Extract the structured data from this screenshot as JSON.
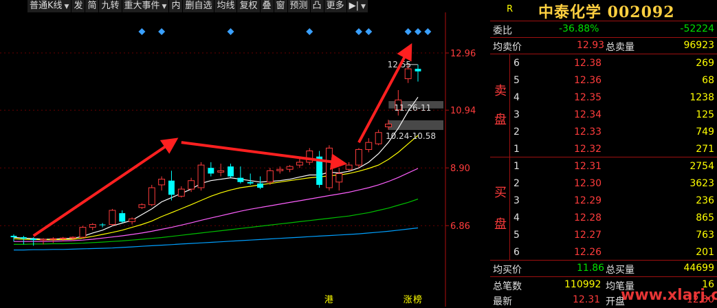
{
  "toolbar": {
    "items": [
      {
        "label": "普通K线",
        "dropdown": true
      },
      {
        "label": "发",
        "dropdown": false
      },
      {
        "label": "简",
        "dropdown": false
      },
      {
        "label": "九转",
        "dropdown": false
      },
      {
        "label": "重大事件",
        "dropdown": true
      },
      {
        "label": "内",
        "dropdown": false
      },
      {
        "label": "删自选",
        "dropdown": false
      },
      {
        "label": "均线",
        "dropdown": false
      },
      {
        "label": "复权",
        "dropdown": false
      },
      {
        "label": "叠",
        "dropdown": false
      },
      {
        "label": "窗",
        "dropdown": false
      },
      {
        "label": "预测",
        "dropdown": false
      },
      {
        "label": "凸",
        "dropdown": false
      },
      {
        "label": "更多",
        "dropdown": false
      },
      {
        "label": "▶|",
        "dropdown": true
      }
    ]
  },
  "chart_data": {
    "type": "candlestick",
    "y_ticks": [
      "12.96",
      "10.94",
      "8.90",
      "6.86"
    ],
    "ylim": [
      4.8,
      14.2
    ],
    "candles": [
      [
        6.5,
        6.55,
        6.3,
        6.45
      ],
      [
        6.45,
        6.5,
        6.2,
        6.4
      ],
      [
        6.4,
        6.45,
        6.15,
        6.35
      ],
      [
        6.35,
        6.42,
        6.2,
        6.38
      ],
      [
        6.38,
        6.45,
        6.25,
        6.4
      ],
      [
        6.4,
        6.46,
        6.3,
        6.42
      ],
      [
        6.42,
        6.48,
        6.32,
        6.45
      ],
      [
        6.45,
        6.85,
        6.4,
        6.8
      ],
      [
        6.8,
        6.95,
        6.7,
        6.9
      ],
      [
        6.9,
        6.95,
        6.8,
        6.88
      ],
      [
        6.9,
        7.45,
        6.85,
        7.4
      ],
      [
        7.3,
        7.4,
        6.95,
        7.0
      ],
      [
        7.0,
        7.15,
        6.9,
        7.1
      ],
      [
        7.5,
        7.65,
        7.45,
        7.6
      ],
      [
        7.6,
        8.3,
        7.55,
        8.2
      ],
      [
        8.3,
        8.6,
        8.1,
        8.5
      ],
      [
        8.45,
        8.8,
        7.75,
        7.95
      ],
      [
        7.9,
        8.25,
        7.85,
        8.15
      ],
      [
        8.15,
        8.55,
        8.05,
        8.45
      ],
      [
        8.2,
        9.1,
        8.1,
        9.0
      ],
      [
        8.9,
        9.1,
        8.6,
        8.7
      ],
      [
        8.75,
        9.05,
        8.6,
        8.8
      ],
      [
        8.95,
        9.05,
        8.55,
        8.6
      ],
      [
        8.55,
        8.95,
        8.35,
        8.4
      ],
      [
        8.4,
        8.7,
        8.3,
        8.35
      ],
      [
        8.35,
        8.6,
        8.15,
        8.2
      ],
      [
        8.4,
        8.9,
        8.3,
        8.8
      ],
      [
        8.8,
        8.95,
        8.7,
        8.85
      ],
      [
        8.85,
        9.0,
        8.75,
        8.95
      ],
      [
        9.0,
        9.25,
        8.9,
        9.1
      ],
      [
        9.1,
        9.6,
        9.0,
        9.5
      ],
      [
        9.3,
        9.5,
        8.2,
        8.3
      ],
      [
        8.2,
        9.7,
        8.1,
        9.6
      ],
      [
        8.4,
        8.9,
        8.1,
        8.7
      ],
      [
        8.85,
        9.1,
        8.8,
        9.0
      ],
      [
        9.0,
        9.6,
        8.9,
        9.55
      ],
      [
        9.55,
        9.95,
        9.45,
        9.8
      ],
      [
        9.75,
        10.25,
        9.7,
        10.15
      ],
      [
        10.35,
        10.6,
        10.25,
        10.45
      ],
      [
        10.95,
        11.65,
        10.75,
        11.3
      ],
      [
        12.05,
        12.55,
        11.9,
        12.4
      ],
      [
        12.4,
        12.55,
        11.95,
        12.31
      ]
    ],
    "ma_series": [
      {
        "color": "#ffffff",
        "values": [
          6.45,
          6.42,
          6.4,
          6.38,
          6.38,
          6.4,
          6.41,
          6.48,
          6.6,
          6.7,
          6.85,
          6.95,
          7.05,
          7.25,
          7.45,
          7.7,
          7.85,
          8.0,
          8.15,
          8.35,
          8.45,
          8.5,
          8.55,
          8.5,
          8.45,
          8.4,
          8.42,
          8.45,
          8.5,
          8.58,
          8.65,
          8.65,
          8.75,
          8.72,
          8.78,
          8.9,
          9.1,
          9.4,
          9.8,
          10.3,
          10.9,
          11.4
        ]
      },
      {
        "color": "#ffff00",
        "values": [
          6.4,
          6.38,
          6.37,
          6.36,
          6.36,
          6.37,
          6.38,
          6.42,
          6.48,
          6.55,
          6.62,
          6.7,
          6.8,
          6.9,
          7.02,
          7.18,
          7.32,
          7.46,
          7.6,
          7.75,
          7.9,
          8.02,
          8.12,
          8.2,
          8.25,
          8.3,
          8.35,
          8.4,
          8.45,
          8.5,
          8.55,
          8.58,
          8.62,
          8.65,
          8.7,
          8.78,
          8.88,
          9.0,
          9.2,
          9.45,
          9.75,
          10.05
        ]
      },
      {
        "color": "#ff60ff",
        "values": [
          6.3,
          6.3,
          6.3,
          6.3,
          6.31,
          6.32,
          6.33,
          6.35,
          6.38,
          6.42,
          6.46,
          6.5,
          6.55,
          6.6,
          6.66,
          6.73,
          6.8,
          6.88,
          6.96,
          7.05,
          7.13,
          7.21,
          7.29,
          7.37,
          7.44,
          7.5,
          7.56,
          7.62,
          7.68,
          7.74,
          7.8,
          7.86,
          7.92,
          7.98,
          8.04,
          8.12,
          8.2,
          8.3,
          8.42,
          8.56,
          8.72,
          8.88
        ]
      },
      {
        "color": "#00c000",
        "values": [
          6.2,
          6.2,
          6.21,
          6.21,
          6.22,
          6.22,
          6.23,
          6.24,
          6.26,
          6.28,
          6.3,
          6.32,
          6.35,
          6.38,
          6.41,
          6.44,
          6.48,
          6.52,
          6.56,
          6.6,
          6.64,
          6.68,
          6.72,
          6.76,
          6.8,
          6.84,
          6.88,
          6.92,
          6.96,
          7.0,
          7.04,
          7.08,
          7.12,
          7.16,
          7.2,
          7.26,
          7.32,
          7.4,
          7.48,
          7.58,
          7.68,
          7.8
        ]
      },
      {
        "color": "#00a0ff",
        "values": [
          6.0,
          6.0,
          6.01,
          6.01,
          6.02,
          6.02,
          6.03,
          6.04,
          6.05,
          6.06,
          6.07,
          6.09,
          6.11,
          6.13,
          6.15,
          6.17,
          6.19,
          6.21,
          6.23,
          6.25,
          6.27,
          6.29,
          6.31,
          6.33,
          6.35,
          6.37,
          6.39,
          6.41,
          6.43,
          6.45,
          6.47,
          6.49,
          6.51,
          6.53,
          6.55,
          6.57,
          6.6,
          6.63,
          6.66,
          6.7,
          6.74,
          6.78
        ]
      }
    ],
    "diamond_indexes": [
      13,
      15,
      22,
      30,
      35,
      36,
      40,
      41,
      42
    ],
    "annotations": {
      "high_label": "12.55",
      "gap1_label": "11.26-11",
      "gap2_label": "10.24-10.58"
    },
    "gaps": [
      [
        11.0,
        11.26
      ],
      [
        10.24,
        10.58
      ]
    ],
    "bottom_markers": [
      {
        "index": 32,
        "text": "港"
      },
      {
        "index": 40,
        "text": "涨"
      },
      {
        "index": 41,
        "text": "榜"
      }
    ],
    "arrows": [
      {
        "from": [
          2,
          6.5
        ],
        "to": [
          16,
          9.8
        ]
      },
      {
        "from": [
          17,
          9.8
        ],
        "to": [
          33,
          9.08
        ]
      },
      {
        "from": [
          35,
          9.8
        ],
        "to": [
          40,
          13.05
        ]
      }
    ]
  },
  "colors": {
    "up": "#ff3c3c",
    "down": "#00ffff",
    "axis": "#b01010"
  },
  "quote": {
    "code_letter": "R",
    "name": "中泰化学 002092",
    "weibi_label": "委比",
    "weibi_pct": "-36.88%",
    "weibi_value": "-52224",
    "avg_sell_label": "均卖价",
    "avg_sell_price": "12.93",
    "total_sell_label": "总卖量",
    "total_sell_vol": "96923",
    "sell_side_label": "卖盘",
    "sell": [
      {
        "level": "6",
        "price": "12.38",
        "vol": "269"
      },
      {
        "level": "5",
        "price": "12.36",
        "vol": "68"
      },
      {
        "level": "4",
        "price": "12.35",
        "vol": "1238"
      },
      {
        "level": "3",
        "price": "12.34",
        "vol": "125"
      },
      {
        "level": "2",
        "price": "12.33",
        "vol": "749"
      },
      {
        "level": "1",
        "price": "12.32",
        "vol": "271"
      }
    ],
    "buy_side_label": "买盘",
    "buy": [
      {
        "level": "1",
        "price": "12.31",
        "vol": "2754"
      },
      {
        "level": "2",
        "price": "12.30",
        "vol": "3623"
      },
      {
        "level": "3",
        "price": "12.29",
        "vol": "236"
      },
      {
        "level": "4",
        "price": "12.28",
        "vol": "865"
      },
      {
        "level": "5",
        "price": "12.27",
        "vol": "763"
      },
      {
        "level": "6",
        "price": "12.26",
        "vol": "201"
      }
    ],
    "avg_buy_label": "均买价",
    "avg_buy_price": "11.86",
    "total_buy_label": "总买量",
    "total_buy_vol": "44699",
    "trades_label": "总笔数",
    "trades_value": "110992",
    "avg_vol_label": "均笔量",
    "avg_vol_value": "16",
    "latest_label": "最新",
    "latest_price": "12.31",
    "open_label": "开盘",
    "open_price": "12.30"
  },
  "watermark": "www.xlarj.com"
}
